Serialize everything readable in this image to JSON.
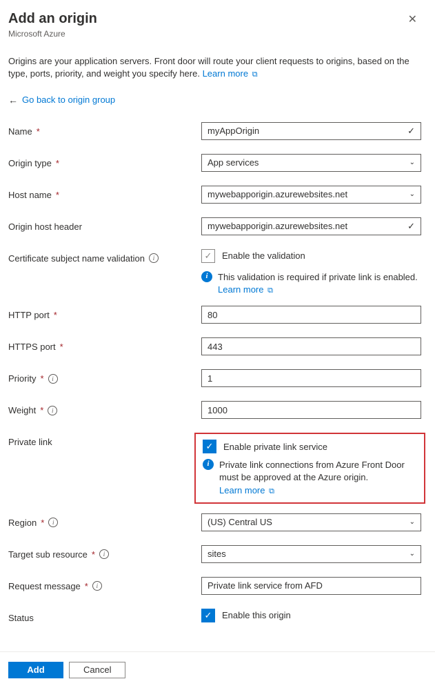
{
  "header": {
    "title": "Add an origin",
    "subtitle": "Microsoft Azure"
  },
  "description": {
    "text": "Origins are your application servers. Front door will route your client requests to origins, based on the type, ports, priority, and weight you specify here.",
    "learn_more": "Learn more"
  },
  "back_link": "Go back to origin group",
  "fields": {
    "name": {
      "label": "Name",
      "value": "myAppOrigin"
    },
    "origin_type": {
      "label": "Origin type",
      "value": "App services"
    },
    "host_name": {
      "label": "Host name",
      "value": "mywebapporigin.azurewebsites.net"
    },
    "origin_host_header": {
      "label": "Origin host header",
      "value": "mywebapporigin.azurewebsites.net"
    },
    "cert_validation": {
      "label": "Certificate subject name validation",
      "checkbox_label": "Enable the validation",
      "info_text": "This validation is required if private link is enabled.",
      "learn_more": "Learn more"
    },
    "http_port": {
      "label": "HTTP port",
      "value": "80"
    },
    "https_port": {
      "label": "HTTPS port",
      "value": "443"
    },
    "priority": {
      "label": "Priority",
      "value": "1"
    },
    "weight": {
      "label": "Weight",
      "value": "1000"
    },
    "private_link": {
      "label": "Private link",
      "checkbox_label": "Enable private link service",
      "info_text": "Private link connections from Azure Front Door must be approved at the Azure origin.",
      "learn_more": "Learn more"
    },
    "region": {
      "label": "Region",
      "value": "(US) Central US"
    },
    "target_sub_resource": {
      "label": "Target sub resource",
      "value": "sites"
    },
    "request_message": {
      "label": "Request message",
      "value": "Private link service from AFD"
    },
    "status": {
      "label": "Status",
      "checkbox_label": "Enable this origin"
    }
  },
  "footer": {
    "add": "Add",
    "cancel": "Cancel"
  }
}
